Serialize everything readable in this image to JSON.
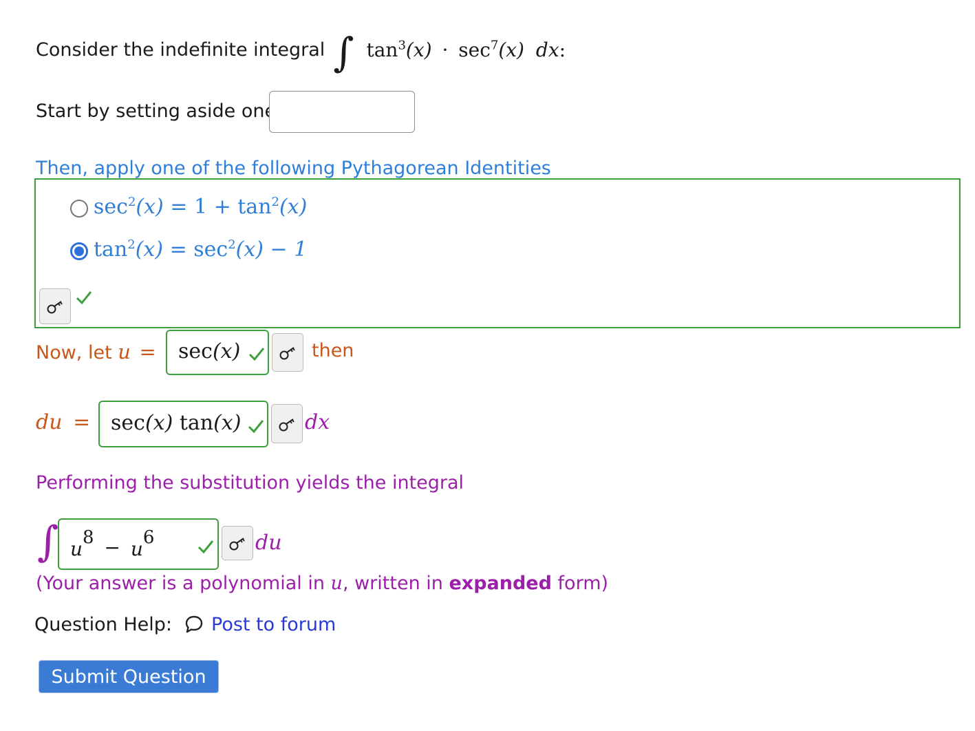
{
  "intro": {
    "prefix": "Consider the indefinite integral",
    "integral_sign": "∫",
    "integrand_tan": "tan",
    "tan_power": "3",
    "arg": "(x)",
    "dot": "·",
    "integrand_sec": "sec",
    "sec_power": "7",
    "arg2": "(x)",
    "dx": "dx",
    "colon": ":"
  },
  "step1": {
    "label": "Start by setting aside one",
    "input_value": ""
  },
  "identities": {
    "heading": "Then, apply one of the following Pythagorean Identities",
    "options": [
      {
        "lhs": "sec",
        "lhs_pow": "2",
        "lhs_arg": "(x)",
        "rhs": "= 1 + tan",
        "rhs_pow": "2",
        "rhs_arg": "(x)",
        "selected": false
      },
      {
        "lhs": "tan",
        "lhs_pow": "2",
        "lhs_arg": "(x)",
        "rhs": "= sec",
        "rhs_pow": "2",
        "rhs_arg": "(x) − 1",
        "selected": true
      }
    ],
    "status": "correct"
  },
  "u_sub": {
    "prefix": "Now, let",
    "var": "u",
    "equals": "=",
    "value": "sec(x)",
    "value_fn": "sec",
    "value_arg": "(x)",
    "suffix": "then",
    "status": "correct"
  },
  "du_step": {
    "lhs": "du",
    "equals": "=",
    "value_fn1": "sec",
    "value_arg1": "(x)",
    "value_fn2": "tan",
    "value_arg2": "(x)",
    "suffix": "dx",
    "status": "correct"
  },
  "substitution": {
    "heading": "Performing the substitution yields the integral",
    "integral_sign": "∫",
    "answer_u1": "u",
    "answer_pow1": "8",
    "answer_minus": "−",
    "answer_u2": "u",
    "answer_pow2": "6",
    "suffix": "du",
    "status": "correct",
    "note_open": "(Your answer is a polynomial in",
    "note_var": "u",
    "note_mid": ", written in",
    "note_bold": "expanded",
    "note_close": "form)"
  },
  "help": {
    "label": "Question Help:",
    "forum_link": "Post to forum"
  },
  "submit": {
    "label": "Submit Question"
  },
  "colors": {
    "blue_heading": "#2f7fd8",
    "orange": "#c8581a",
    "purple": "#9b1fa8",
    "green": "#3f9f3f",
    "link": "#2a3ad6",
    "button_bg": "#3a7bd5"
  }
}
